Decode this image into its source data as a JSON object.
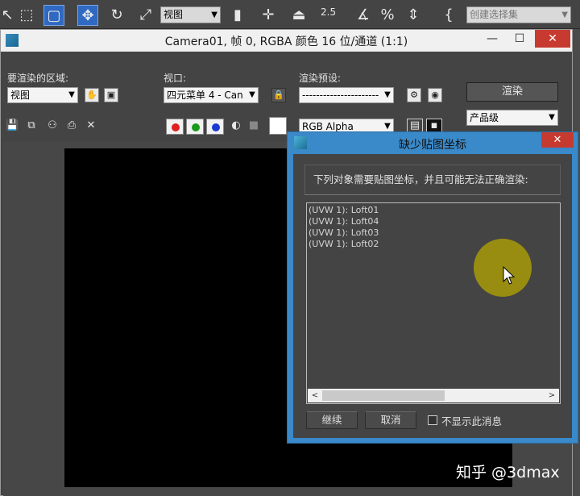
{
  "toolbar": {
    "view_select": "视图",
    "spinner_value": "2.5",
    "selection_set_placeholder": "创建选择集"
  },
  "render_window": {
    "title": "Camera01, 帧 0, RGBA 颜色 16 位/通道 (1:1)",
    "area_label": "要渲染的区域:",
    "area_value": "视图",
    "viewport_label": "视口:",
    "viewport_value": "四元菜单 4 - Can",
    "preset_label": "渲染预设:",
    "preset_value": "----------------------",
    "render_button": "渲染",
    "quality_value": "产品级",
    "channel_value": "RGB Alpha",
    "swatch_colors": [
      "#e02020",
      "#1a9a1a",
      "#1a3ad0"
    ]
  },
  "dialog": {
    "title": "缺少贴图坐标",
    "message": "下列对象需要贴图坐标，并且可能无法正确渲染:",
    "items": [
      "(UVW 1): Loft01",
      "(UVW 1): Loft04",
      "(UVW 1): Loft03",
      "(UVW 1): Loft02"
    ],
    "continue_button": "继续",
    "cancel_button": "取消",
    "dont_show_label": "不显示此消息"
  },
  "watermark": "知乎 @3dmax",
  "colors": {
    "dialog_frame": "#3a89c9",
    "close_red": "#c73a30",
    "cursor_halo": "#b4a500"
  }
}
